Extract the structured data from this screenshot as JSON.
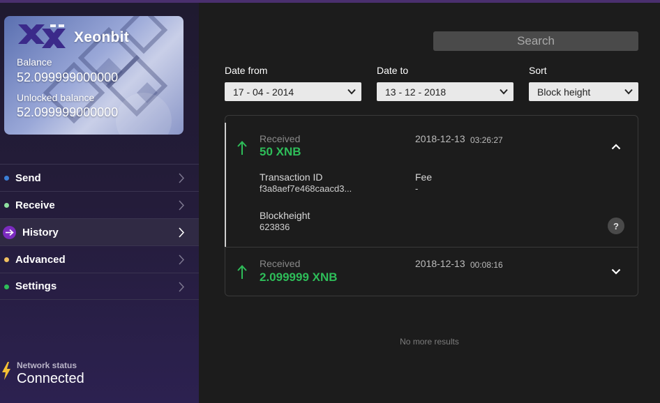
{
  "card": {
    "brand": "Xeonbit",
    "balance_label": "Balance",
    "balance_value": "52.099999000000",
    "unlocked_label": "Unlocked balance",
    "unlocked_value": "52.099999000000"
  },
  "nav": {
    "items": [
      {
        "label": "Send",
        "dot_color": "#3b7fd6"
      },
      {
        "label": "Receive",
        "dot_color": "#8fe0a0"
      },
      {
        "label": "History",
        "dot_color": "#7b2bbf"
      },
      {
        "label": "Advanced",
        "dot_color": "#f0c060"
      },
      {
        "label": "Settings",
        "dot_color": "#2ebd59"
      }
    ],
    "active": "History"
  },
  "network": {
    "label": "Network status",
    "value": "Connected",
    "icon": "bolt-icon",
    "icon_color": "#f4c034"
  },
  "search": {
    "placeholder": "Search"
  },
  "filters": {
    "date_from_label": "Date from",
    "date_from_value": "17 - 04 -  2014",
    "date_to_label": "Date to",
    "date_to_value": "13 - 12 -  2018",
    "sort_label": "Sort",
    "sort_value": "Block height"
  },
  "transactions": [
    {
      "kind": "Received",
      "amount": "50 XNB",
      "date": "2018-12-13",
      "time": "03:26:27",
      "expanded": true,
      "txid_label": "Transaction ID",
      "txid": "f3a8aef7e468caacd3...",
      "fee_label": "Fee",
      "fee": "-",
      "blockheight_label": "Blockheight",
      "blockheight": "623836",
      "help": "?"
    },
    {
      "kind": "Received",
      "amount": "2.099999 XNB",
      "date": "2018-12-13",
      "time": "00:08:16",
      "expanded": false
    }
  ],
  "footer": {
    "no_more": "No more results"
  },
  "colors": {
    "accent": "#7b2bbf",
    "received": "#2ebd59",
    "panel": "#1c1c1c"
  }
}
